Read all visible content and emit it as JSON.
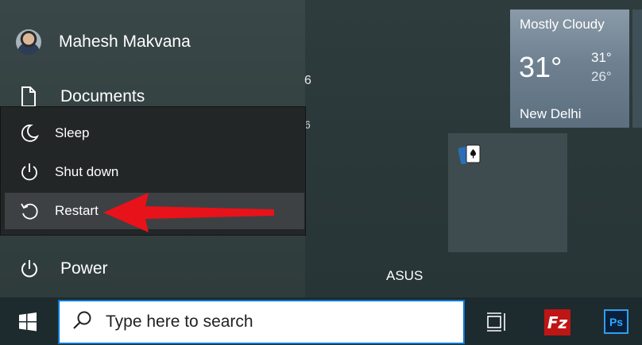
{
  "account": {
    "name": "Mahesh Makvana"
  },
  "start_menu": {
    "documents_label": "Documents",
    "power_label": "Power"
  },
  "power_menu": {
    "items": [
      {
        "label": "Sleep",
        "icon": "moon-icon"
      },
      {
        "label": "Shut down",
        "icon": "power-icon"
      },
      {
        "label": "Restart",
        "icon": "restart-icon",
        "highlighted": true
      }
    ]
  },
  "stray_text": {
    "a": "6",
    "b": "6"
  },
  "weather_tile": {
    "condition": "Mostly Cloudy",
    "temp": "31°",
    "high": "31°",
    "low": "26°",
    "city": "New Delhi"
  },
  "tiles": {
    "asus_label": "ASUS"
  },
  "taskbar": {
    "search_placeholder": "Type here to search",
    "filezilla_label": "Fz",
    "photoshop_label": "Ps"
  },
  "colors": {
    "accent": "#0078d7",
    "annotation_arrow": "#e8121a",
    "filezilla": "#bf1515"
  }
}
